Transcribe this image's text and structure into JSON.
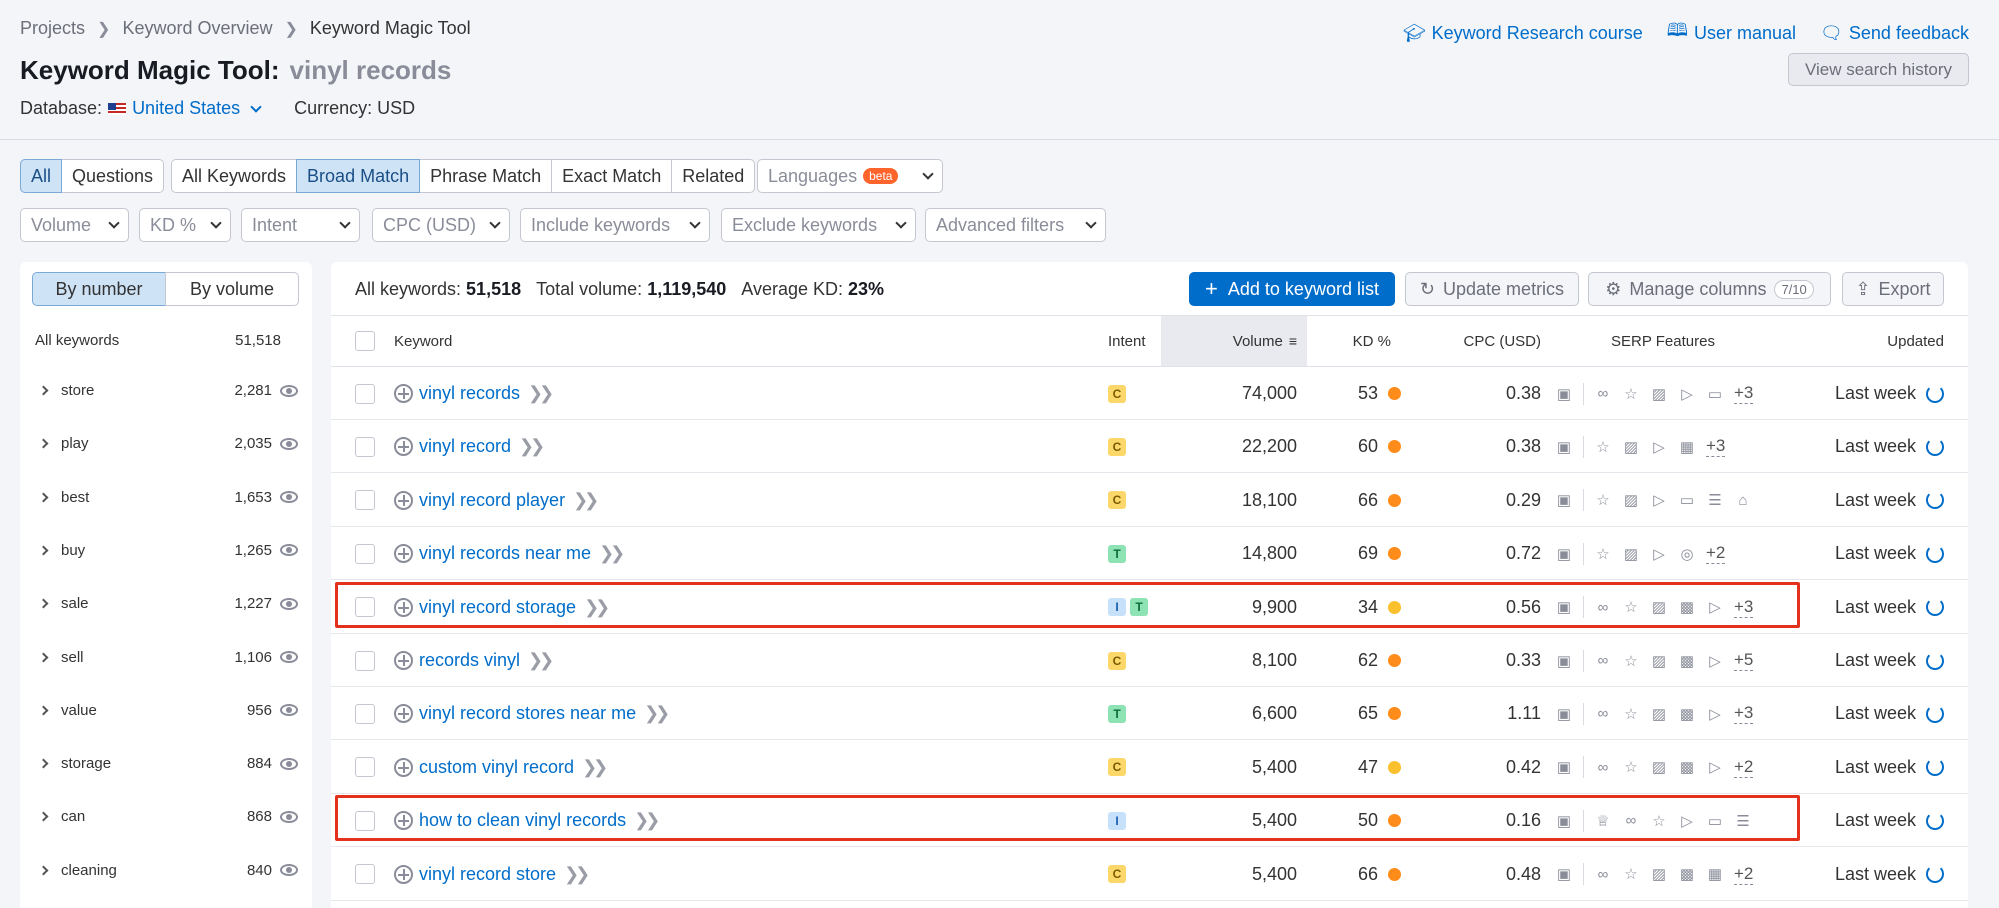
{
  "breadcrumb": [
    "Projects",
    "Keyword Overview",
    "Keyword Magic Tool"
  ],
  "top_links": [
    "Keyword Research course",
    "User manual",
    "Send feedback"
  ],
  "title": {
    "label": "Keyword Magic Tool:",
    "keyword": "vinyl records"
  },
  "view_history": "View search history",
  "database": {
    "label": "Database:",
    "value": "United States",
    "currency": "Currency: USD"
  },
  "match_tabs": {
    "group1": [
      "All",
      "Questions"
    ],
    "group2": [
      "All Keywords",
      "Broad Match",
      "Phrase Match",
      "Exact Match",
      "Related"
    ],
    "languages": "Languages",
    "beta": "beta"
  },
  "filters": [
    "Volume",
    "KD %",
    "Intent",
    "CPC (USD)",
    "Include keywords",
    "Exclude keywords",
    "Advanced filters"
  ],
  "left_panel": {
    "toggle": [
      "By number",
      "By volume"
    ],
    "header": {
      "label": "All keywords",
      "count": "51,518"
    },
    "groups": [
      {
        "name": "store",
        "count": "2,281"
      },
      {
        "name": "play",
        "count": "2,035"
      },
      {
        "name": "best",
        "count": "1,653"
      },
      {
        "name": "buy",
        "count": "1,265"
      },
      {
        "name": "sale",
        "count": "1,227"
      },
      {
        "name": "sell",
        "count": "1,106"
      },
      {
        "name": "value",
        "count": "956"
      },
      {
        "name": "storage",
        "count": "884"
      },
      {
        "name": "can",
        "count": "868"
      },
      {
        "name": "cleaning",
        "count": "840"
      }
    ]
  },
  "summary": {
    "all_label": "All keywords:",
    "all_value": "51,518",
    "vol_label": "Total volume:",
    "vol_value": "1,119,540",
    "kd_label": "Average KD:",
    "kd_value": "23%"
  },
  "actions": {
    "add": "Add to keyword list",
    "update": "Update metrics",
    "manage": "Manage columns",
    "manage_count": "7/10",
    "export": "Export"
  },
  "columns": [
    "Keyword",
    "Intent",
    "Volume",
    "KD %",
    "CPC (USD)",
    "SERP Features",
    "Updated"
  ],
  "colors": {
    "orange": "#ff8c1a",
    "yellow": "#fbc02d",
    "accent": "#006dca",
    "highlight": "#e3311d"
  },
  "rows": [
    {
      "keyword": "vinyl records",
      "intent": [
        "C"
      ],
      "volume": "74,000",
      "kd": "53",
      "kd_color": "#ff8c1a",
      "cpc": "0.38",
      "serp": [
        "snippet-icon",
        "link-icon",
        "star-icon",
        "image-icon",
        "video-icon",
        "chat-icon"
      ],
      "more": "+3",
      "updated": "Last week",
      "highlight": false
    },
    {
      "keyword": "vinyl record",
      "intent": [
        "C"
      ],
      "volume": "22,200",
      "kd": "60",
      "kd_color": "#ff8c1a",
      "cpc": "0.38",
      "serp": [
        "snippet-icon",
        "star-icon",
        "image-icon",
        "video-icon",
        "film-icon"
      ],
      "more": "+3",
      "updated": "Last week",
      "highlight": false
    },
    {
      "keyword": "vinyl record player",
      "intent": [
        "C"
      ],
      "volume": "18,100",
      "kd": "66",
      "kd_color": "#ff8c1a",
      "cpc": "0.29",
      "serp": [
        "snippet-icon",
        "star-icon",
        "image-icon",
        "video-icon",
        "chat-icon",
        "list-icon",
        "cart-icon"
      ],
      "more": "",
      "updated": "Last week",
      "highlight": false
    },
    {
      "keyword": "vinyl records near me",
      "intent": [
        "T"
      ],
      "volume": "14,800",
      "kd": "69",
      "kd_color": "#ff8c1a",
      "cpc": "0.72",
      "serp": [
        "snippet-icon",
        "star-icon",
        "image-icon",
        "video-icon",
        "pin-icon"
      ],
      "more": "+2",
      "updated": "Last week",
      "highlight": false
    },
    {
      "keyword": "vinyl record storage",
      "intent": [
        "I",
        "T"
      ],
      "volume": "9,900",
      "kd": "34",
      "kd_color": "#fbc02d",
      "cpc": "0.56",
      "serp": [
        "snippet-icon",
        "link-icon",
        "star-icon",
        "image-icon",
        "gallery-icon",
        "video-icon"
      ],
      "more": "+3",
      "updated": "Last week",
      "highlight": true
    },
    {
      "keyword": "records vinyl",
      "intent": [
        "C"
      ],
      "volume": "8,100",
      "kd": "62",
      "kd_color": "#ff8c1a",
      "cpc": "0.33",
      "serp": [
        "snippet-icon",
        "link-icon",
        "star-icon",
        "image-icon",
        "gallery-icon",
        "video-icon"
      ],
      "more": "+5",
      "updated": "Last week",
      "highlight": false
    },
    {
      "keyword": "vinyl record stores near me",
      "intent": [
        "T"
      ],
      "volume": "6,600",
      "kd": "65",
      "kd_color": "#ff8c1a",
      "cpc": "1.11",
      "serp": [
        "snippet-icon",
        "link-icon",
        "star-icon",
        "image-icon",
        "gallery-icon",
        "video-icon"
      ],
      "more": "+3",
      "updated": "Last week",
      "highlight": false
    },
    {
      "keyword": "custom vinyl record",
      "intent": [
        "C"
      ],
      "volume": "5,400",
      "kd": "47",
      "kd_color": "#fbc02d",
      "cpc": "0.42",
      "serp": [
        "snippet-icon",
        "link-icon",
        "star-icon",
        "image-icon",
        "gallery-icon",
        "video-icon"
      ],
      "more": "+2",
      "updated": "Last week",
      "highlight": false
    },
    {
      "keyword": "how to clean vinyl records",
      "intent": [
        "I"
      ],
      "volume": "5,400",
      "kd": "50",
      "kd_color": "#ff8c1a",
      "cpc": "0.16",
      "serp": [
        "snippet-icon",
        "crown-icon",
        "link-icon",
        "star-icon",
        "video-icon",
        "chat-icon",
        "list-icon"
      ],
      "more": "",
      "updated": "Last week",
      "highlight": true
    },
    {
      "keyword": "vinyl record store",
      "intent": [
        "C"
      ],
      "volume": "5,400",
      "kd": "66",
      "kd_color": "#ff8c1a",
      "cpc": "0.48",
      "serp": [
        "snippet-icon",
        "link-icon",
        "star-icon",
        "image-icon",
        "gallery-icon",
        "film-icon"
      ],
      "more": "+2",
      "updated": "Last week",
      "highlight": false
    }
  ]
}
